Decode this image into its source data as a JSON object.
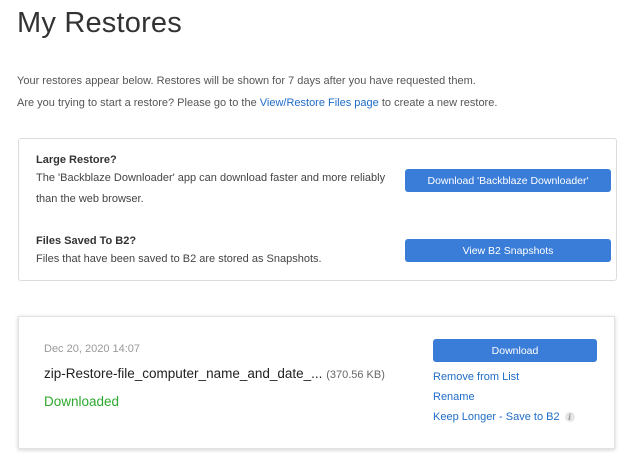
{
  "page": {
    "title": "My Restores",
    "intro_line1": "Your restores appear below. Restores will be shown for 7 days after you have requested them.",
    "intro_line2_before": "Are you trying to start a restore? Please go to the ",
    "intro_link": "View/Restore Files page",
    "intro_line2_after": " to create a new restore."
  },
  "info": {
    "large_restore": {
      "heading": "Large Restore?",
      "text": "The 'Backblaze Downloader' app can download faster and more reliably than the web browser.",
      "button": "Download 'Backblaze Downloader'"
    },
    "b2": {
      "heading": "Files Saved To B2?",
      "text": "Files that have been saved to B2 are stored as Snapshots.",
      "button": "View B2 Snapshots"
    }
  },
  "restore": {
    "date": "Dec 20, 2020 14:07",
    "filename": "zip-Restore-file_computer_name_and_date_...",
    "size": "(370.56 KB)",
    "status": "Downloaded",
    "download_button": "Download",
    "remove_link": "Remove from List",
    "rename_link": "Rename",
    "keep_longer_link": "Keep Longer - Save to B2",
    "info_icon": "i"
  },
  "colors": {
    "accent": "#3a7dd8",
    "link": "#1f6cc7",
    "status_ok": "#2ea82e"
  }
}
